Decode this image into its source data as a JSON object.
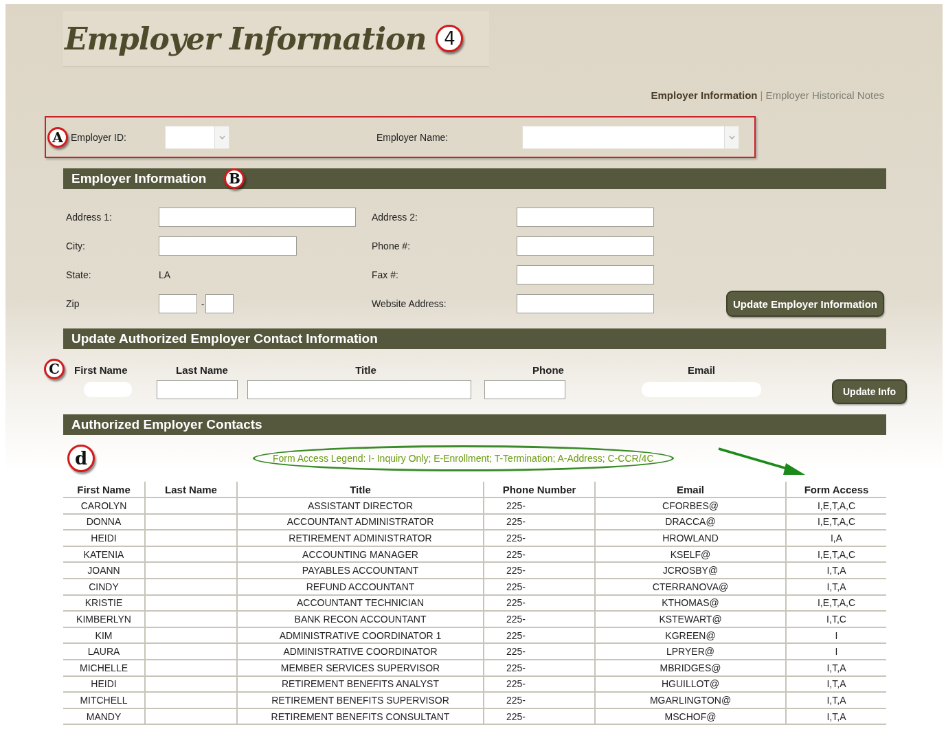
{
  "page_title": {
    "text": "Employer Information",
    "badge": "4"
  },
  "nav": {
    "separator": "|",
    "items": [
      {
        "label": "Employer Information",
        "selected": true
      },
      {
        "label": "Employer Historical Notes",
        "selected": false
      }
    ]
  },
  "selector": {
    "badge": "A",
    "fields": [
      {
        "label": "Employer ID:",
        "kind": "short"
      },
      {
        "label": "Employer Name:",
        "kind": "long"
      }
    ]
  },
  "employer_section": {
    "title": "Employer Information",
    "badge": "B",
    "fields": [
      {
        "label": "Address 1:",
        "kind": "long-input"
      },
      {
        "label": "Address 2:",
        "kind": "input"
      },
      {
        "label": "City:",
        "kind": "mid-input"
      },
      {
        "label": "Phone #:",
        "kind": "input"
      },
      {
        "label": "State:",
        "kind": "text",
        "value": "LA"
      },
      {
        "label": "Fax #:",
        "kind": "input"
      },
      {
        "label": "Zip",
        "kind": "zip",
        "separator": "-"
      },
      {
        "label": "Website Address:",
        "kind": "input"
      }
    ],
    "button": "Update Employer Information"
  },
  "contact_section": {
    "title": "Update Authorized Employer Contact Information",
    "badge": "C",
    "columns": [
      {
        "label": "First Name",
        "kind": "masked"
      },
      {
        "label": "Last Name",
        "kind": "input"
      },
      {
        "label": "Title",
        "kind": "wide"
      },
      {
        "label": "Phone",
        "kind": "input"
      },
      {
        "label": "Email",
        "kind": "masked"
      }
    ],
    "button": "Update Info"
  },
  "contacts_section": {
    "title": "Authorized Employer Contacts",
    "badge": "d",
    "legend": "Form Access Legend: I- Inquiry Only; E-Enrollment; T-Termination; A-Address; C-CCR/4C",
    "table": {
      "columns": [
        "First Name",
        "Last Name",
        "Title",
        "Phone Number",
        "Email",
        "Form Access"
      ],
      "rows": [
        {
          "first_name": "CAROLYN",
          "title": "ASSISTANT DIRECTOR",
          "phone": "225-",
          "email": "CFORBES@",
          "form_access": "I,E,T,A,C"
        },
        {
          "first_name": "DONNA",
          "title": "ACCOUNTANT ADMINISTRATOR",
          "phone": "225-",
          "email": "DRACCA@",
          "form_access": "I,E,T,A,C"
        },
        {
          "first_name": "HEIDI",
          "title": "RETIREMENT ADMINISTRATOR",
          "phone": "225-",
          "email": "HROWLAND",
          "form_access": "I,A"
        },
        {
          "first_name": "KATENIA",
          "title": "ACCOUNTING MANAGER",
          "phone": "225-",
          "email": "KSELF@",
          "form_access": "I,E,T,A,C"
        },
        {
          "first_name": "JOANN",
          "title": "PAYABLES ACCOUNTANT",
          "phone": "225-",
          "email": "JCROSBY@",
          "form_access": "I,T,A"
        },
        {
          "first_name": "CINDY",
          "title": "REFUND ACCOUNTANT",
          "phone": "225-",
          "email": "CTERRANOVA@",
          "form_access": "I,T,A"
        },
        {
          "first_name": "KRISTIE",
          "title": "ACCOUNTANT TECHNICIAN",
          "phone": "225-",
          "email": "KTHOMAS@",
          "form_access": "I,E,T,A,C"
        },
        {
          "first_name": "KIMBERLYN",
          "title": "BANK RECON ACCOUNTANT",
          "phone": "225-",
          "email": "KSTEWART@",
          "form_access": "I,T,C"
        },
        {
          "first_name": "KIM",
          "title": "ADMINISTRATIVE COORDINATOR 1",
          "phone": "225-",
          "email": "KGREEN@",
          "form_access": "I"
        },
        {
          "first_name": "LAURA",
          "title": "ADMINISTRATIVE COORDINATOR",
          "phone": "225-",
          "email": "LPRYER@",
          "form_access": "I"
        },
        {
          "first_name": "MICHELLE",
          "title": "MEMBER SERVICES SUPERVISOR",
          "phone": "225-",
          "email": "MBRIDGES@",
          "form_access": "I,T,A"
        },
        {
          "first_name": "HEIDI",
          "title": "RETIREMENT BENEFITS ANALYST",
          "phone": "225-",
          "email": "HGUILLOT@",
          "form_access": "I,T,A"
        },
        {
          "first_name": "MITCHELL",
          "title": "RETIREMENT BENEFITS SUPERVISOR",
          "phone": "225-",
          "email": "MGARLINGTON@",
          "form_access": "I,T,A"
        },
        {
          "first_name": "MANDY",
          "title": "RETIREMENT BENEFITS CONSULTANT",
          "phone": "225-",
          "email": "MSCHOF@",
          "form_access": "I,T,A"
        }
      ]
    }
  }
}
